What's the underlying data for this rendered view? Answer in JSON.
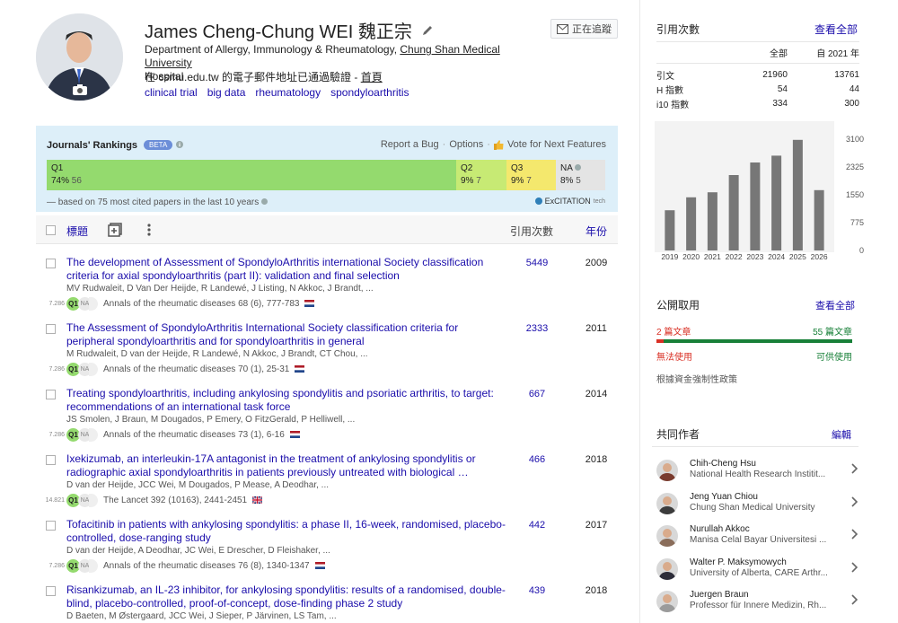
{
  "profile": {
    "name": "James Cheng-Chung WEI 魏正宗",
    "follow_label": "正在追蹤",
    "affil_prefix": "Department of Allergy, Immunology & Rheumatology, ",
    "affil_university": "Chung Shan Medical University",
    "affil_suffix": "Hospital",
    "email_text": "在 csmu.edu.tw 的電子郵件地址已通過驗證 - ",
    "homepage_label": "首頁",
    "interests": [
      "clinical trial",
      "big data",
      "rheumatology",
      "spondyloarthritis"
    ]
  },
  "rankings": {
    "title": "Journals' Rankings",
    "beta": "BETA",
    "report_bug": "Report a Bug",
    "options": "Options",
    "vote": "Vote for Next Features",
    "q1": {
      "label": "Q1",
      "pct": "74%",
      "count": "56"
    },
    "q2": {
      "label": "Q2",
      "pct": "9%",
      "count": "7"
    },
    "q3": {
      "label": "Q3",
      "pct": "9%",
      "count": "7"
    },
    "na": {
      "label": "NA",
      "pct": "8%",
      "count": "5"
    },
    "footer": "— based on 75 most cited papers in the last 10 years",
    "brand": "ExCITATION",
    "brand_suffix": "tech"
  },
  "table": {
    "title_col": "標題",
    "cited_col": "引用次數",
    "year_col": "年份"
  },
  "articles": [
    {
      "title": "The development of Assessment of SpondyloArthritis international Society classification criteria for axial spondyloarthritis (part II): validation and final selection",
      "authors": "MV Rudwaleit, D Van Der Heijde, R Landewé, J Listing, N Akkoc, J Brandt, ...",
      "score": "7.286",
      "journal": "Annals of the rheumatic diseases 68 (6), 777-783",
      "flag": "nl",
      "cited": "5449",
      "year": "2009"
    },
    {
      "title": "The Assessment of SpondyloArthritis International Society classification criteria for peripheral spondyloarthritis and for spondyloarthritis in general",
      "authors": "M Rudwaleit, D van der Heijde, R Landewé, N Akkoc, J Brandt, CT Chou, ...",
      "score": "7.286",
      "journal": "Annals of the rheumatic diseases 70 (1), 25-31",
      "flag": "nl",
      "cited": "2333",
      "year": "2011"
    },
    {
      "title": "Treating spondyloarthritis, including ankylosing spondylitis and psoriatic arthritis, to target: recommendations of an international task force",
      "authors": "JS Smolen, J Braun, M Dougados, P Emery, O FitzGerald, P Helliwell, ...",
      "score": "7.286",
      "journal": "Annals of the rheumatic diseases 73 (1), 6-16",
      "flag": "nl",
      "cited": "667",
      "year": "2014"
    },
    {
      "title": "Ixekizumab, an interleukin-17A antagonist in the treatment of ankylosing spondylitis or radiographic axial spondyloarthritis in patients previously untreated with biological …",
      "authors": "D van der Heijde, JCC Wei, M Dougados, P Mease, A Deodhar, ...",
      "score": "14.821",
      "journal": "The Lancet 392 (10163), 2441-2451",
      "flag": "uk",
      "cited": "466",
      "year": "2018"
    },
    {
      "title": "Tofacitinib in patients with ankylosing spondylitis: a phase II, 16-week, randomised, placebo-controlled, dose-ranging study",
      "authors": "D van der Heijde, A Deodhar, JC Wei, E Drescher, D Fleishaker, ...",
      "score": "7.286",
      "journal": "Annals of the rheumatic diseases 76 (8), 1340-1347",
      "flag": "nl",
      "cited": "442",
      "year": "2017"
    },
    {
      "title": "Risankizumab, an IL-23 inhibitor, for ankylosing spondylitis: results of a randomised, double-blind, placebo-controlled, proof-of-concept, dose-finding phase 2 study",
      "authors": "D Baeten, M Østergaard, JCC Wei, J Sieper, P Järvinen, LS Tam, ...",
      "score": "",
      "journal": "",
      "flag": "",
      "cited": "439",
      "year": "2018"
    }
  ],
  "citations": {
    "title": "引用次數",
    "view_all": "查看全部",
    "col_all": "全部",
    "col_since": "自 2021 年",
    "rows": [
      {
        "label": "引文",
        "all": "21960",
        "since": "13761"
      },
      {
        "label": "H 指數",
        "all": "54",
        "since": "44"
      },
      {
        "label": "i10 指數",
        "all": "334",
        "since": "300"
      }
    ]
  },
  "chart_data": {
    "type": "bar",
    "categories": [
      "2019",
      "2020",
      "2021",
      "2022",
      "2023",
      "2024",
      "2025",
      "2026"
    ],
    "values": [
      1120,
      1480,
      1620,
      2100,
      2450,
      2640,
      3080,
      1680
    ],
    "yticks": [
      "0",
      "775",
      "1550",
      "2325",
      "3100"
    ],
    "ylim": [
      0,
      3100
    ],
    "bar_color": "#777777"
  },
  "public_access": {
    "title": "公開取用",
    "view_all": "查看全部",
    "not_available_count": "2 篇文章",
    "available_count": "55 篇文章",
    "not_available_label": "無法使用",
    "available_label": "可供使用",
    "available_fraction": 0.965,
    "policy": "根據資金強制性政策"
  },
  "coauthors": {
    "title": "共同作者",
    "edit": "編輯",
    "items": [
      {
        "name": "Chih-Cheng Hsu",
        "affil": "National Health Research Institit..."
      },
      {
        "name": "Jeng Yuan Chiou",
        "affil": "Chung Shan Medical University"
      },
      {
        "name": "Nurullah Akkoc",
        "affil": "Manisa Celal Bayar Üniversitesi ..."
      },
      {
        "name": "Walter P. Maksymowych",
        "affil": "University of Alberta, CARE Arthr..."
      },
      {
        "name": "Juergen Braun",
        "affil": "Professor für Innere Medizin, Rh..."
      }
    ]
  }
}
